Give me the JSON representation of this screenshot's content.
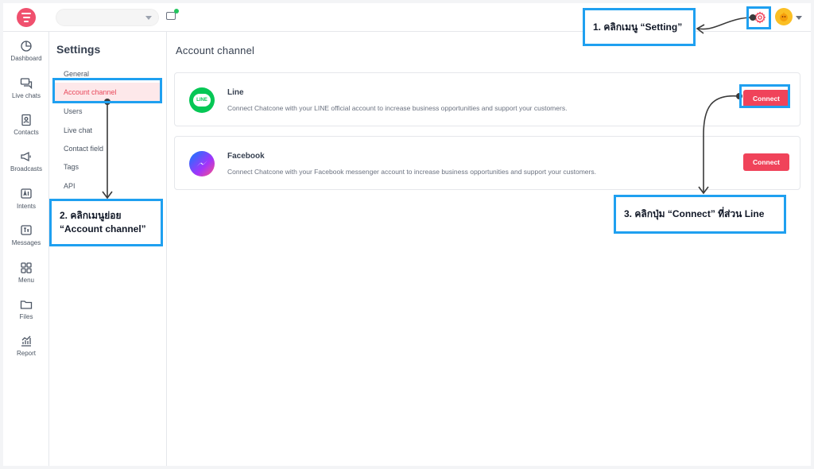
{
  "topbar": {
    "workspace_value": "",
    "status_color": "#22c55e"
  },
  "sidebar": {
    "items": [
      {
        "label": "Dashboard",
        "icon": "dashboard-icon"
      },
      {
        "label": "Live chats",
        "icon": "chat-icon"
      },
      {
        "label": "Contacts",
        "icon": "contacts-icon"
      },
      {
        "label": "Broadcasts",
        "icon": "megaphone-icon"
      },
      {
        "label": "Intents",
        "icon": "ai-icon"
      },
      {
        "label": "Messages",
        "icon": "message-text-icon"
      },
      {
        "label": "Menu",
        "icon": "grid-icon"
      },
      {
        "label": "Files",
        "icon": "folder-icon"
      },
      {
        "label": "Report",
        "icon": "chart-icon"
      }
    ]
  },
  "settings": {
    "title": "Settings",
    "items": [
      "General",
      "Account channel",
      "Users",
      "Live chat",
      "Contact field",
      "Tags",
      "API"
    ],
    "active": "Account channel"
  },
  "main": {
    "title": "Account channel",
    "channels": [
      {
        "name": "Line",
        "icon_text": "LINE",
        "description": "Connect Chatcone with your LINE official account to increase business opportunities and support your customers.",
        "button": "Connect"
      },
      {
        "name": "Facebook",
        "description": "Connect Chatcone with your Facebook messenger account to increase business opportunities and support your customers.",
        "button": "Connect"
      }
    ]
  },
  "annotations": {
    "step1": "1. คลิกเมนู “Setting”",
    "step2_line1": "2. คลิกเมนูย่อย",
    "step2_line2": "“Account channel”",
    "step3": "3. คลิกปุ่ม “Connect” ที่ส่วน Line"
  },
  "colors": {
    "brand": "#f0506e",
    "connect": "#f0435a",
    "active_bg": "#fde8ea",
    "annotation": "#1fa0f0",
    "line_green": "#06c755"
  }
}
